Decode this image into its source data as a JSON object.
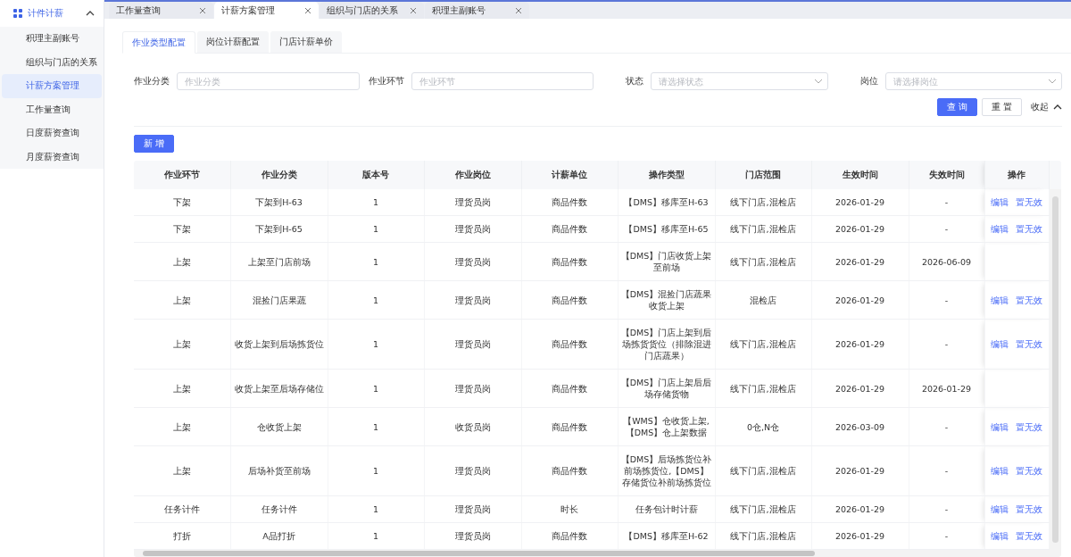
{
  "sidebar": {
    "group": {
      "label": "计件计薪",
      "expanded": true
    },
    "items": [
      {
        "label": "积理主副账号",
        "selected": false
      },
      {
        "label": "组织与门店的关系",
        "selected": false
      },
      {
        "label": "计薪方案管理",
        "selected": true
      },
      {
        "label": "工作量查询",
        "selected": false
      },
      {
        "label": "日度薪资查询",
        "selected": false
      },
      {
        "label": "月度薪资查询",
        "selected": false
      }
    ]
  },
  "page_tabs": [
    {
      "label": "工作量查询",
      "selected": false
    },
    {
      "label": "计薪方案管理",
      "selected": true
    },
    {
      "label": "组织与门店的关系",
      "selected": false
    },
    {
      "label": "积理主副账号",
      "selected": false
    }
  ],
  "sub_tabs": [
    {
      "label": "作业类型配置",
      "selected": true
    },
    {
      "label": "岗位计薪配置",
      "selected": false
    },
    {
      "label": "门店计薪单价",
      "selected": false
    }
  ],
  "filters": [
    {
      "label": "作业分类",
      "kind": "input",
      "placeholder": "作业分类"
    },
    {
      "label": "作业环节",
      "kind": "input",
      "placeholder": "作业环节"
    },
    {
      "label": "状态",
      "kind": "select",
      "placeholder": "请选择状态"
    },
    {
      "label": "岗位",
      "kind": "select",
      "placeholder": "请选择岗位"
    }
  ],
  "query_button": "查 询",
  "reset_button": "重 置",
  "collapse_link": {
    "label": "收起",
    "expanded": true
  },
  "add_button": "新 增",
  "table": {
    "columns": [
      "作业环节",
      "作业分类",
      "版本号",
      "作业岗位",
      "计薪单位",
      "操作类型",
      "门店范围",
      "生效时间",
      "失效时间",
      "操作"
    ],
    "rows": [
      {
        "cells": [
          "下架",
          "下架到H-63",
          "1",
          "理货员岗",
          "商品件数",
          "【DMS】移库至H-63",
          "线下门店,混检店",
          "2026-01-29",
          "-"
        ],
        "actions": [
          "编辑",
          "置无效"
        ]
      },
      {
        "cells": [
          "下架",
          "下架到H-65",
          "1",
          "理货员岗",
          "商品件数",
          "【DMS】移库至H-65",
          "线下门店,混检店",
          "2026-01-29",
          "-"
        ],
        "actions": [
          "编辑",
          "置无效"
        ]
      },
      {
        "cells": [
          "上架",
          "上架至门店前场",
          "1",
          "理货员岗",
          "商品件数",
          "【DMS】门店收货上架至前场",
          "线下门店,混检店",
          "2026-01-29",
          "2026-06-09"
        ],
        "actions": []
      },
      {
        "cells": [
          "上架",
          "混捡门店果蔬",
          "1",
          "理货员岗",
          "商品件数",
          "【DMS】混捡门店蔬果收货上架",
          "混检店",
          "2026-01-29",
          "-"
        ],
        "actions": [
          "编辑",
          "置无效"
        ]
      },
      {
        "cells": [
          "上架",
          "收货上架到后场拣货位",
          "1",
          "理货员岗",
          "商品件数",
          "【DMS】门店上架到后场拣货货位（排除混进门店蔬果）",
          "线下门店,混检店",
          "2026-01-29",
          "-"
        ],
        "actions": [
          "编辑",
          "置无效"
        ]
      },
      {
        "cells": [
          "上架",
          "收货上架至后场存储位",
          "1",
          "理货员岗",
          "商品件数",
          "【DMS】门店上架后后场存储货物",
          "线下门店,混检店",
          "2026-01-29",
          "2026-01-29"
        ],
        "actions": []
      },
      {
        "cells": [
          "上架",
          "仓收货上架",
          "1",
          "收货员岗",
          "商品件数",
          "【WMS】仓收货上架,【DMS】仓上架数据",
          "0仓,N仓",
          "2026-03-09",
          "-"
        ],
        "actions": [
          "编辑",
          "置无效"
        ]
      },
      {
        "cells": [
          "上架",
          "后场补货至前场",
          "1",
          "理货员岗",
          "商品件数",
          "【DMS】后场拣货位补前场拣货位,【DMS】存储货位补前场拣货位",
          "线下门店,混检店",
          "2026-01-29",
          "-"
        ],
        "actions": [
          "编辑",
          "置无效"
        ]
      },
      {
        "cells": [
          "任务计件",
          "任务计件",
          "1",
          "理货员岗",
          "时长",
          "任务包计时计薪",
          "线下门店,混检店",
          "2026-01-29",
          "-"
        ],
        "actions": [
          "编辑",
          "置无效"
        ]
      },
      {
        "cells": [
          "打折",
          "A品打折",
          "1",
          "理货员岗",
          "商品件数",
          "【DMS】移库至H-62",
          "线下门店,混检店",
          "2026-01-29",
          "-"
        ],
        "actions": [
          "编辑",
          "置无效"
        ]
      }
    ]
  }
}
